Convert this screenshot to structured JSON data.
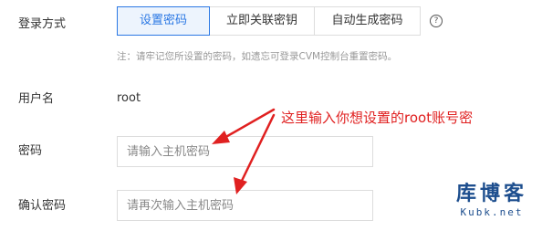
{
  "login": {
    "label": "登录方式",
    "options": [
      {
        "label": "设置密码",
        "active": true
      },
      {
        "label": "立即关联密钥",
        "active": false
      },
      {
        "label": "自动生成密码",
        "active": false
      }
    ],
    "help_icon": "question-circle-icon",
    "help_glyph": "?",
    "note": "注：请牢记您所设置的密码，如遗忘可登录CVM控制台重置密码。"
  },
  "username": {
    "label": "用户名",
    "value": "root"
  },
  "password": {
    "label": "密码",
    "placeholder": "请输入主机密码"
  },
  "confirm": {
    "label": "确认密码",
    "placeholder": "请再次输入主机密码"
  },
  "annotation": {
    "text": "这里输入你想设置的root账号密",
    "color": "#e02020"
  },
  "watermark": {
    "main": "库博客",
    "sub": "Kubk.net",
    "color": "#1d4e8e"
  },
  "colors": {
    "accent": "#2b78e4",
    "active_bg": "#edf4fd",
    "border": "#dddddd",
    "note": "#999999"
  }
}
